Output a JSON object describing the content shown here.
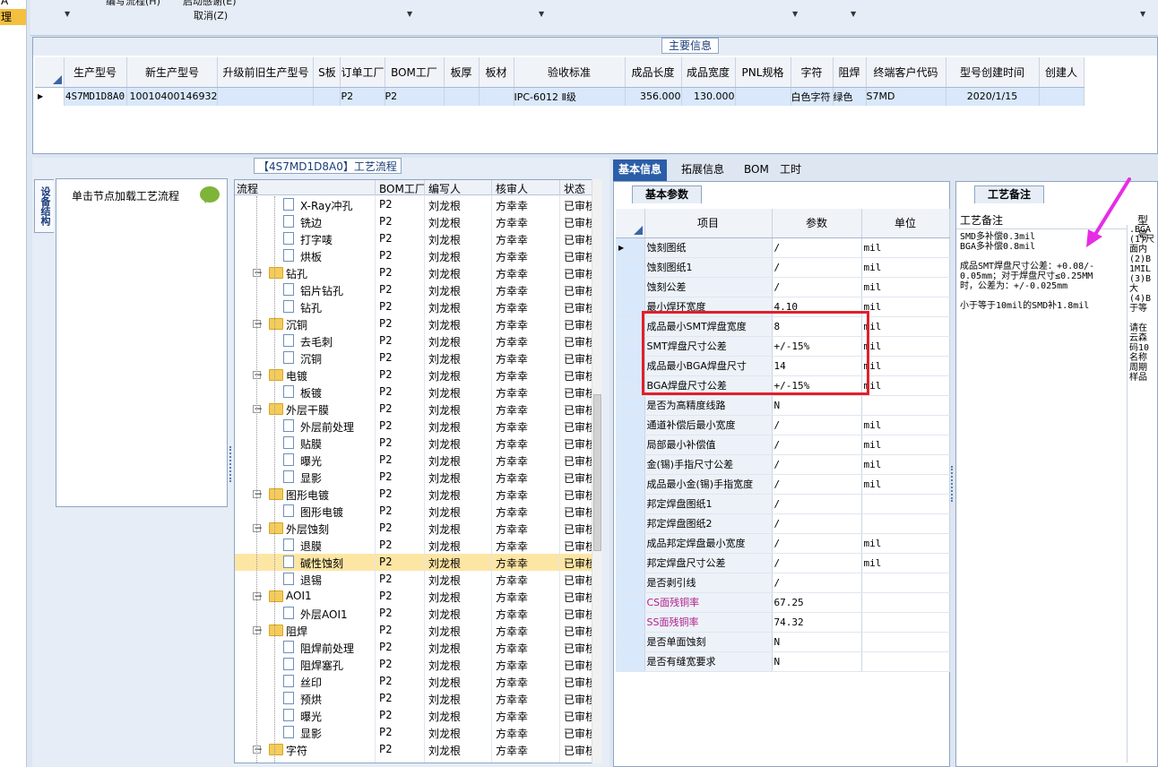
{
  "left_strip": {
    "items": [
      "A",
      "理"
    ]
  },
  "toolbar": {
    "top_labels": [
      "编写流程(H)",
      "启动感谢(E)"
    ],
    "cancel_label": "取消(Z)"
  },
  "main_info": {
    "title": "主要信息",
    "columns": [
      "生产型号",
      "新生产型号",
      "升级前旧生产型号",
      "S板",
      "订单工厂",
      "BOM工厂",
      "板厚",
      "板材",
      "验收标准",
      "成品长度",
      "成品宽度",
      "PNL规格",
      "字符",
      "阻焊",
      "终端客户代码",
      "型号创建时间",
      "创建人"
    ],
    "row": [
      "4S7MD1D8A0",
      "10010400146932",
      "",
      "",
      "P2",
      "P2",
      "",
      "",
      "IPC-6012 Ⅱ级",
      "356.000",
      "130.000",
      "",
      "白色字符",
      "绿色",
      "S7MD",
      "2020/1/15",
      ""
    ]
  },
  "process": {
    "title": "【4S7MD1D8A0】工艺流程",
    "vertical_tab": "设备结构",
    "hint": "单击节点加载工艺流程",
    "columns": [
      "流程",
      "BOM工厂",
      "编写人",
      "核审人",
      "状态"
    ],
    "rows": [
      {
        "name": "X-Ray冲孔",
        "type": "doc",
        "level": 2,
        "bom": "P2",
        "writer": "刘龙根",
        "reviewer": "方幸幸",
        "status": "已审核"
      },
      {
        "name": "铣边",
        "type": "doc",
        "level": 2,
        "bom": "P2",
        "writer": "刘龙根",
        "reviewer": "方幸幸",
        "status": "已审核"
      },
      {
        "name": "打字唛",
        "type": "doc",
        "level": 2,
        "bom": "P2",
        "writer": "刘龙根",
        "reviewer": "方幸幸",
        "status": "已审核"
      },
      {
        "name": "烘板",
        "type": "doc",
        "level": 2,
        "bom": "P2",
        "writer": "刘龙根",
        "reviewer": "方幸幸",
        "status": "已审核"
      },
      {
        "name": "钻孔",
        "type": "folder",
        "level": 1,
        "bom": "P2",
        "writer": "刘龙根",
        "reviewer": "方幸幸",
        "status": "已审核"
      },
      {
        "name": "铝片钻孔",
        "type": "doc",
        "level": 2,
        "bom": "P2",
        "writer": "刘龙根",
        "reviewer": "方幸幸",
        "status": "已审核"
      },
      {
        "name": "钻孔",
        "type": "doc",
        "level": 2,
        "bom": "P2",
        "writer": "刘龙根",
        "reviewer": "方幸幸",
        "status": "已审核"
      },
      {
        "name": "沉铜",
        "type": "folder",
        "level": 1,
        "bom": "P2",
        "writer": "刘龙根",
        "reviewer": "方幸幸",
        "status": "已审核"
      },
      {
        "name": "去毛刺",
        "type": "doc",
        "level": 2,
        "bom": "P2",
        "writer": "刘龙根",
        "reviewer": "方幸幸",
        "status": "已审核"
      },
      {
        "name": "沉铜",
        "type": "doc",
        "level": 2,
        "bom": "P2",
        "writer": "刘龙根",
        "reviewer": "方幸幸",
        "status": "已审核"
      },
      {
        "name": "电镀",
        "type": "folder",
        "level": 1,
        "bom": "P2",
        "writer": "刘龙根",
        "reviewer": "方幸幸",
        "status": "已审核"
      },
      {
        "name": "板镀",
        "type": "doc",
        "level": 2,
        "bom": "P2",
        "writer": "刘龙根",
        "reviewer": "方幸幸",
        "status": "已审核"
      },
      {
        "name": "外层干膜",
        "type": "folder",
        "level": 1,
        "bom": "P2",
        "writer": "刘龙根",
        "reviewer": "方幸幸",
        "status": "已审核"
      },
      {
        "name": "外层前处理",
        "type": "doc",
        "level": 2,
        "bom": "P2",
        "writer": "刘龙根",
        "reviewer": "方幸幸",
        "status": "已审核"
      },
      {
        "name": "贴膜",
        "type": "doc",
        "level": 2,
        "bom": "P2",
        "writer": "刘龙根",
        "reviewer": "方幸幸",
        "status": "已审核"
      },
      {
        "name": "曝光",
        "type": "doc",
        "level": 2,
        "bom": "P2",
        "writer": "刘龙根",
        "reviewer": "方幸幸",
        "status": "已审核"
      },
      {
        "name": "显影",
        "type": "doc",
        "level": 2,
        "bom": "P2",
        "writer": "刘龙根",
        "reviewer": "方幸幸",
        "status": "已审核"
      },
      {
        "name": "图形电镀",
        "type": "folder",
        "level": 1,
        "bom": "P2",
        "writer": "刘龙根",
        "reviewer": "方幸幸",
        "status": "已审核"
      },
      {
        "name": "图形电镀",
        "type": "doc",
        "level": 2,
        "bom": "P2",
        "writer": "刘龙根",
        "reviewer": "方幸幸",
        "status": "已审核"
      },
      {
        "name": "外层蚀刻",
        "type": "folder",
        "level": 1,
        "bom": "P2",
        "writer": "刘龙根",
        "reviewer": "方幸幸",
        "status": "已审核"
      },
      {
        "name": "退膜",
        "type": "doc",
        "level": 2,
        "bom": "P2",
        "writer": "刘龙根",
        "reviewer": "方幸幸",
        "status": "已审核"
      },
      {
        "name": "碱性蚀刻",
        "type": "doc",
        "level": 2,
        "bom": "P2",
        "writer": "刘龙根",
        "reviewer": "方幸幸",
        "status": "已审核",
        "selected": true
      },
      {
        "name": "退锡",
        "type": "doc",
        "level": 2,
        "bom": "P2",
        "writer": "刘龙根",
        "reviewer": "方幸幸",
        "status": "已审核"
      },
      {
        "name": "AOI1",
        "type": "folder",
        "level": 1,
        "bom": "P2",
        "writer": "刘龙根",
        "reviewer": "方幸幸",
        "status": "已审核"
      },
      {
        "name": "外层AOI1",
        "type": "doc",
        "level": 2,
        "bom": "P2",
        "writer": "刘龙根",
        "reviewer": "方幸幸",
        "status": "已审核"
      },
      {
        "name": "阻焊",
        "type": "folder",
        "level": 1,
        "bom": "P2",
        "writer": "刘龙根",
        "reviewer": "方幸幸",
        "status": "已审核"
      },
      {
        "name": "阻焊前处理",
        "type": "doc",
        "level": 2,
        "bom": "P2",
        "writer": "刘龙根",
        "reviewer": "方幸幸",
        "status": "已审核"
      },
      {
        "name": "阻焊塞孔",
        "type": "doc",
        "level": 2,
        "bom": "P2",
        "writer": "刘龙根",
        "reviewer": "方幸幸",
        "status": "已审核"
      },
      {
        "name": "丝印",
        "type": "doc",
        "level": 2,
        "bom": "P2",
        "writer": "刘龙根",
        "reviewer": "方幸幸",
        "status": "已审核"
      },
      {
        "name": "预烘",
        "type": "doc",
        "level": 2,
        "bom": "P2",
        "writer": "刘龙根",
        "reviewer": "方幸幸",
        "status": "已审核"
      },
      {
        "name": "曝光",
        "type": "doc",
        "level": 2,
        "bom": "P2",
        "writer": "刘龙根",
        "reviewer": "方幸幸",
        "status": "已审核"
      },
      {
        "name": "显影",
        "type": "doc",
        "level": 2,
        "bom": "P2",
        "writer": "刘龙根",
        "reviewer": "方幸幸",
        "status": "已审核"
      },
      {
        "name": "字符",
        "type": "folder",
        "level": 1,
        "bom": "P2",
        "writer": "刘龙根",
        "reviewer": "方幸幸",
        "status": "已审核"
      }
    ]
  },
  "basic": {
    "tabs": [
      "基本信息",
      "拓展信息",
      "BOM",
      "工时"
    ],
    "subtab": "基本参数",
    "columns": [
      "项目",
      "参数",
      "单位"
    ],
    "rows": [
      {
        "item": "蚀刻图纸",
        "param": "/",
        "unit": "mil"
      },
      {
        "item": "蚀刻图纸1",
        "param": "/",
        "unit": "mil"
      },
      {
        "item": "蚀刻公差",
        "param": "/",
        "unit": "mil"
      },
      {
        "item": "最小焊环宽度",
        "param": "4.10",
        "unit": "mil"
      },
      {
        "item": "成品最小SMT焊盘宽度",
        "param": "8",
        "unit": "mil"
      },
      {
        "item": "SMT焊盘尺寸公差",
        "param": "+/-15%",
        "unit": "mil"
      },
      {
        "item": "成品最小BGA焊盘尺寸",
        "param": "14",
        "unit": "mil"
      },
      {
        "item": "BGA焊盘尺寸公差",
        "param": "+/-15%",
        "unit": "mil"
      },
      {
        "item": "是否为高精度线路",
        "param": "N",
        "unit": ""
      },
      {
        "item": "通道补偿后最小宽度",
        "param": "/",
        "unit": "mil"
      },
      {
        "item": "局部最小补偿值",
        "param": "/",
        "unit": "mil"
      },
      {
        "item": "金(锡)手指尺寸公差",
        "param": "/",
        "unit": "mil"
      },
      {
        "item": "成品最小金(锡)手指宽度",
        "param": "/",
        "unit": "mil"
      },
      {
        "item": "邦定焊盘图纸1",
        "param": "/",
        "unit": ""
      },
      {
        "item": "邦定焊盘图纸2",
        "param": "/",
        "unit": ""
      },
      {
        "item": "成品邦定焊盘最小宽度",
        "param": "/",
        "unit": "mil"
      },
      {
        "item": "邦定焊盘尺寸公差",
        "param": "/",
        "unit": "mil"
      },
      {
        "item": "是否剥引线",
        "param": "/",
        "unit": ""
      },
      {
        "item": "CS面残铜率",
        "param": "67.25",
        "unit": "",
        "magenta": true
      },
      {
        "item": "SS面残铜率",
        "param": "74.32",
        "unit": "",
        "magenta": true
      },
      {
        "item": "是否单面蚀刻",
        "param": "N",
        "unit": ""
      },
      {
        "item": "是否有缝宽要求",
        "param": "N",
        "unit": ""
      }
    ]
  },
  "notes": {
    "subtab": "工艺备注",
    "col1": "工艺备注",
    "col2": "型号",
    "lines": [
      "SMD多补偿0.3mil",
      "BGA多补偿0.8mil",
      "",
      "成品SMT焊盘尺寸公差：+0.08/-",
      "0.05mm；对于焊盘尺寸≤0.25MM",
      "时，公差为：+/-0.025mm",
      "",
      "小于等于10mil的SMD补1.8mil"
    ],
    "col2_lines": [
      ".BGA",
      "(1)尺",
      "面内",
      "(2)B",
      "1MIL",
      "(3)B",
      "大",
      "(4)B",
      "于等",
      "",
      "请在",
      "云森",
      "码10",
      "名称",
      "周期",
      "样品"
    ]
  },
  "colors": {
    "accent": "#2b5ea8",
    "highlight_box": "#e0202a",
    "arrow": "#e62ce6",
    "selected_row": "#fde6a4"
  }
}
